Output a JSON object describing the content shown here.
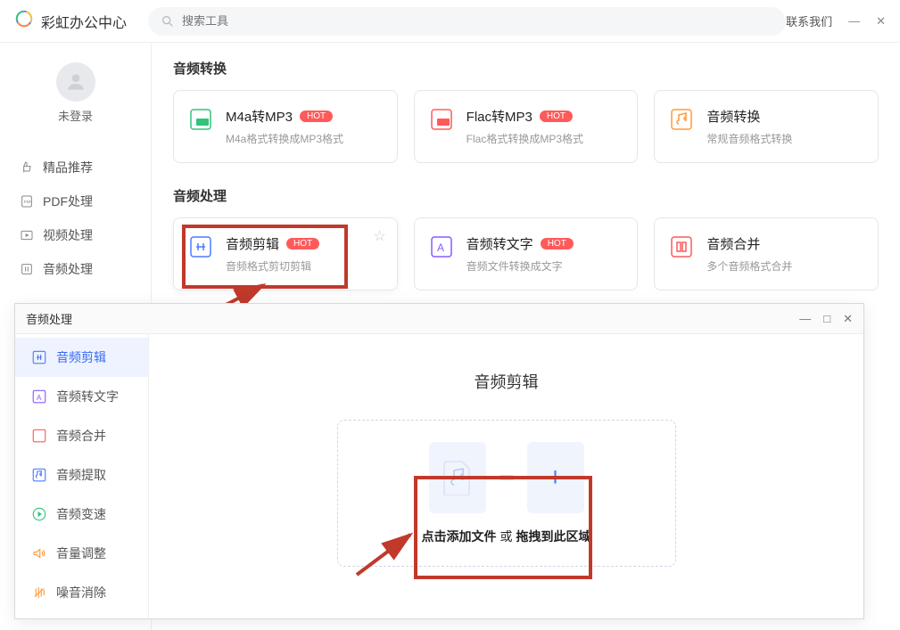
{
  "app": {
    "title": "彩虹办公中心"
  },
  "search": {
    "placeholder": "搜索工具"
  },
  "topbar": {
    "contact": "联系我们"
  },
  "user": {
    "status": "未登录"
  },
  "nav": {
    "featured": "精品推荐",
    "pdf": "PDF处理",
    "video": "视频处理",
    "audio": "音频处理"
  },
  "sections": {
    "audio_convert": "音频转换",
    "audio_process": "音频处理"
  },
  "cards": {
    "m4a": {
      "title": "M4a转MP3",
      "desc": "M4a格式转换成MP3格式",
      "hot": "HOT"
    },
    "flac": {
      "title": "Flac转MP3",
      "desc": "Flac格式转换成MP3格式",
      "hot": "HOT"
    },
    "convert": {
      "title": "音频转换",
      "desc": "常规音频格式转换"
    },
    "edit": {
      "title": "音频剪辑",
      "desc": "音频格式剪切剪辑",
      "hot": "HOT"
    },
    "totext": {
      "title": "音频转文字",
      "desc": "音频文件转换成文字",
      "hot": "HOT"
    },
    "merge": {
      "title": "音频合并",
      "desc": "多个音频格式合并"
    }
  },
  "subwin": {
    "title": "音频处理",
    "items": {
      "edit": "音频剪辑",
      "totext": "音频转文字",
      "merge": "音频合并",
      "extract": "音频提取",
      "speed": "音频变速",
      "volume": "音量调整",
      "denoise": "噪音消除"
    },
    "heading": "音频剪辑",
    "drop_add": "点击添加文件",
    "drop_or": "或",
    "drop_drag": "拖拽到此区域"
  }
}
